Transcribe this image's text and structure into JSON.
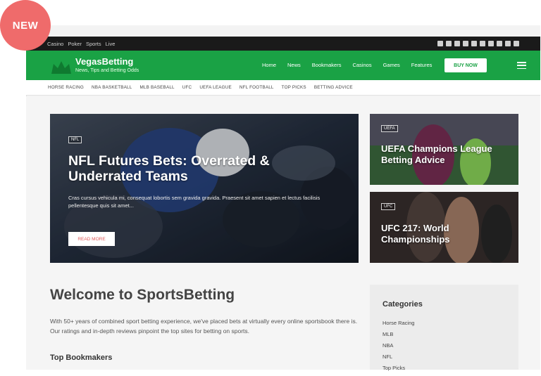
{
  "badge": "NEW",
  "topbar": {
    "links": [
      "Casino",
      "Poker",
      "Sports",
      "Live"
    ]
  },
  "header": {
    "brand_name": "VegasBetting",
    "tagline": "News, Tips and Betting Odds",
    "nav": [
      "Home",
      "News",
      "Bookmakers",
      "Casinos",
      "Games",
      "Features"
    ],
    "cta": "BUY NOW",
    "accent": "#1aa245"
  },
  "subnav": [
    "HORSE RACING",
    "NBA BASKETBALL",
    "MLB BASEBALL",
    "UFC",
    "UEFA LEAGUE",
    "NFL FOOTBALL",
    "TOP PICKS",
    "BETTING ADVICE"
  ],
  "hero": {
    "tag": "NFL",
    "title": "NFL Futures Bets: Overrated & Underrated Teams",
    "excerpt": "Cras cursus vehicula mi, consequat lobortis sem gravida gravida. Praesent sit amet sapien et lectus facilisis pellentesque quis sit amet...",
    "button": "READ MORE"
  },
  "side_cards": [
    {
      "tag": "UEFA",
      "title": "UEFA Champions League Betting Advice"
    },
    {
      "tag": "UFC",
      "title": "UFC 217: World Championships"
    }
  ],
  "main": {
    "heading": "Welcome to SportsBetting",
    "intro": "With 50+ years of combined sport betting experience, we've placed bets at virtually every online sportsbook there is. Our ratings and in-depth reviews pinpoint the top sites for betting on sports.",
    "subheading": "Top Bookmakers"
  },
  "categories": {
    "title": "Categories",
    "items": [
      "Horse Racing",
      "MLB",
      "NBA",
      "NFL",
      "Top Picks"
    ]
  }
}
